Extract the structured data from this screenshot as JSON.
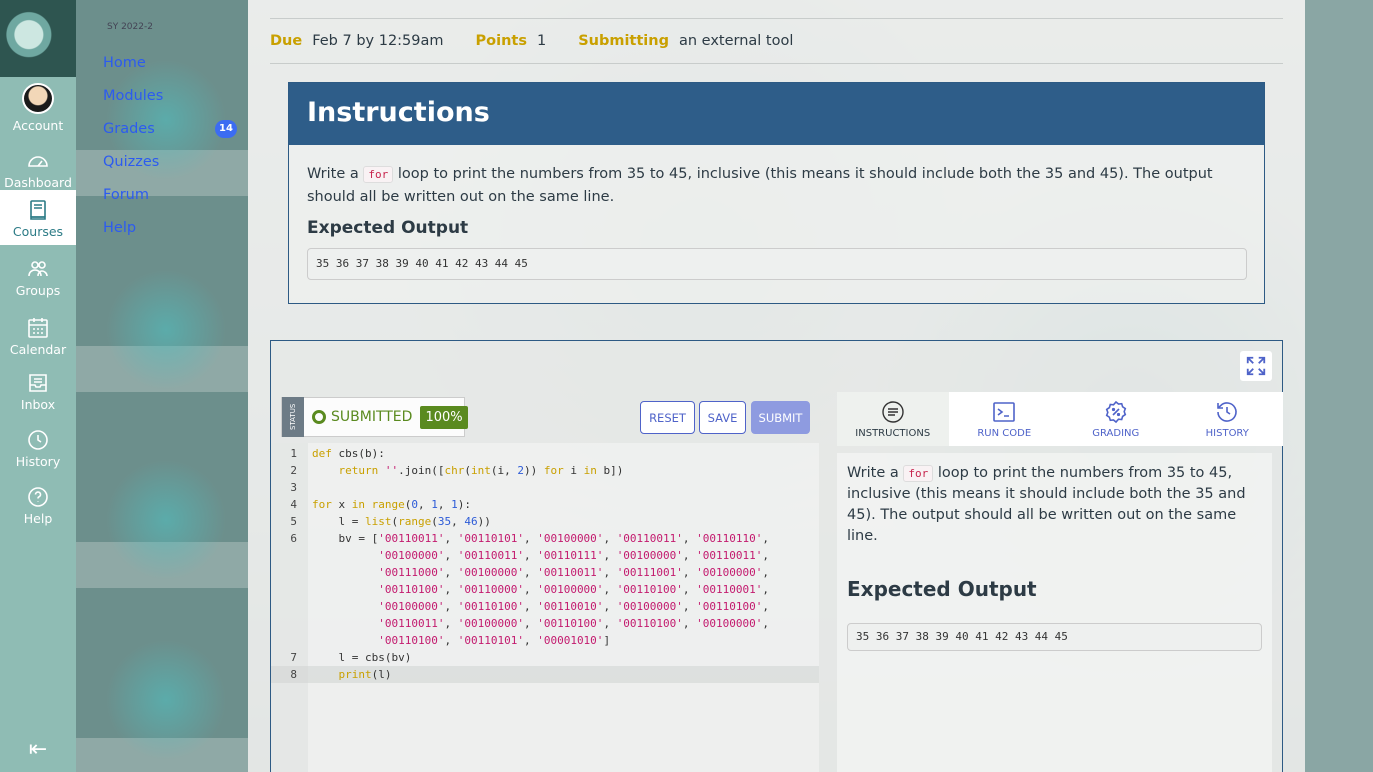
{
  "global_nav": {
    "items": [
      {
        "label": "Account"
      },
      {
        "label": "Dashboard"
      },
      {
        "label": "Courses"
      },
      {
        "label": "Groups"
      },
      {
        "label": "Calendar"
      },
      {
        "label": "Inbox"
      },
      {
        "label": "History"
      },
      {
        "label": "Help"
      }
    ]
  },
  "course_nav": {
    "term": "SY 2022-2",
    "links": [
      "Home",
      "Modules",
      "Grades",
      "Quizzes",
      "Forum",
      "Help"
    ],
    "grades_badge": "14"
  },
  "meta": {
    "due_label": "Due",
    "due_value": "Feb 7 by 12:59am",
    "points_label": "Points",
    "points_value": "1",
    "submitting_label": "Submitting",
    "submitting_value": "an external tool"
  },
  "instructions": {
    "title": "Instructions",
    "text_before": "Write a",
    "keyword": "for",
    "text_after": "loop to print the numbers from 35 to 45, inclusive (this means it should include both the 35 and 45). The output should all be written out on the same line.",
    "expected_label": "Expected Output",
    "expected_output": "35 36 37 38 39 40 41 42 43 44 45"
  },
  "tool": {
    "status_tab": "STATUS",
    "status_label": "SUBMITTED",
    "status_pct": "100%",
    "reset_label": "RESET",
    "save_label": "SAVE",
    "submit_label": "SUBMIT",
    "tabs": [
      "INSTRUCTIONS",
      "RUN CODE",
      "GRADING",
      "HISTORY"
    ]
  },
  "code_lines": [
    {
      "n": "1",
      "text": "def cbs(b):"
    },
    {
      "n": "2",
      "text": "    return ''.join([chr(int(i, 2)) for i in b])"
    },
    {
      "n": "3",
      "text": ""
    },
    {
      "n": "4",
      "text": "for x in range(0, 1, 1):"
    },
    {
      "n": "5",
      "text": "    l = list(range(35, 46))"
    },
    {
      "n": "6",
      "text": "    bv = ['00110011', '00110101', '00100000', '00110011', '00110110',"
    },
    {
      "n": "",
      "text": "          '00100000', '00110011', '00110111', '00100000', '00110011',"
    },
    {
      "n": "",
      "text": "          '00111000', '00100000', '00110011', '00111001', '00100000',"
    },
    {
      "n": "",
      "text": "          '00110100', '00110000', '00100000', '00110100', '00110001',"
    },
    {
      "n": "",
      "text": "          '00100000', '00110100', '00110010', '00100000', '00110100',"
    },
    {
      "n": "",
      "text": "          '00110011', '00100000', '00110100', '00110100', '00100000',"
    },
    {
      "n": "",
      "text": "          '00110100', '00110101', '00001010']"
    },
    {
      "n": "7",
      "text": "    l = cbs(bv)"
    },
    {
      "n": "8",
      "text": "    print(l)"
    }
  ]
}
